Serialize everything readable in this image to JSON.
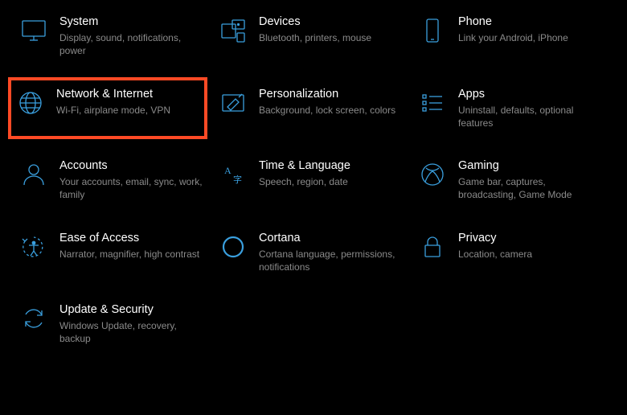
{
  "highlight_color": "#ff4a25",
  "accent_color": "#3a9fde",
  "tiles": [
    {
      "id": "system",
      "title": "System",
      "desc": "Display, sound, notifications, power"
    },
    {
      "id": "devices",
      "title": "Devices",
      "desc": "Bluetooth, printers, mouse"
    },
    {
      "id": "phone",
      "title": "Phone",
      "desc": "Link your Android, iPhone"
    },
    {
      "id": "network",
      "title": "Network & Internet",
      "desc": "Wi-Fi, airplane mode, VPN",
      "highlighted": true
    },
    {
      "id": "personalization",
      "title": "Personalization",
      "desc": "Background, lock screen, colors"
    },
    {
      "id": "apps",
      "title": "Apps",
      "desc": "Uninstall, defaults, optional features"
    },
    {
      "id": "accounts",
      "title": "Accounts",
      "desc": "Your accounts, email, sync, work, family"
    },
    {
      "id": "time",
      "title": "Time & Language",
      "desc": "Speech, region, date"
    },
    {
      "id": "gaming",
      "title": "Gaming",
      "desc": "Game bar, captures, broadcasting, Game Mode"
    },
    {
      "id": "ease",
      "title": "Ease of Access",
      "desc": "Narrator, magnifier, high contrast"
    },
    {
      "id": "cortana",
      "title": "Cortana",
      "desc": "Cortana language, permissions, notifications"
    },
    {
      "id": "privacy",
      "title": "Privacy",
      "desc": "Location, camera"
    },
    {
      "id": "update",
      "title": "Update & Security",
      "desc": "Windows Update, recovery, backup"
    }
  ]
}
